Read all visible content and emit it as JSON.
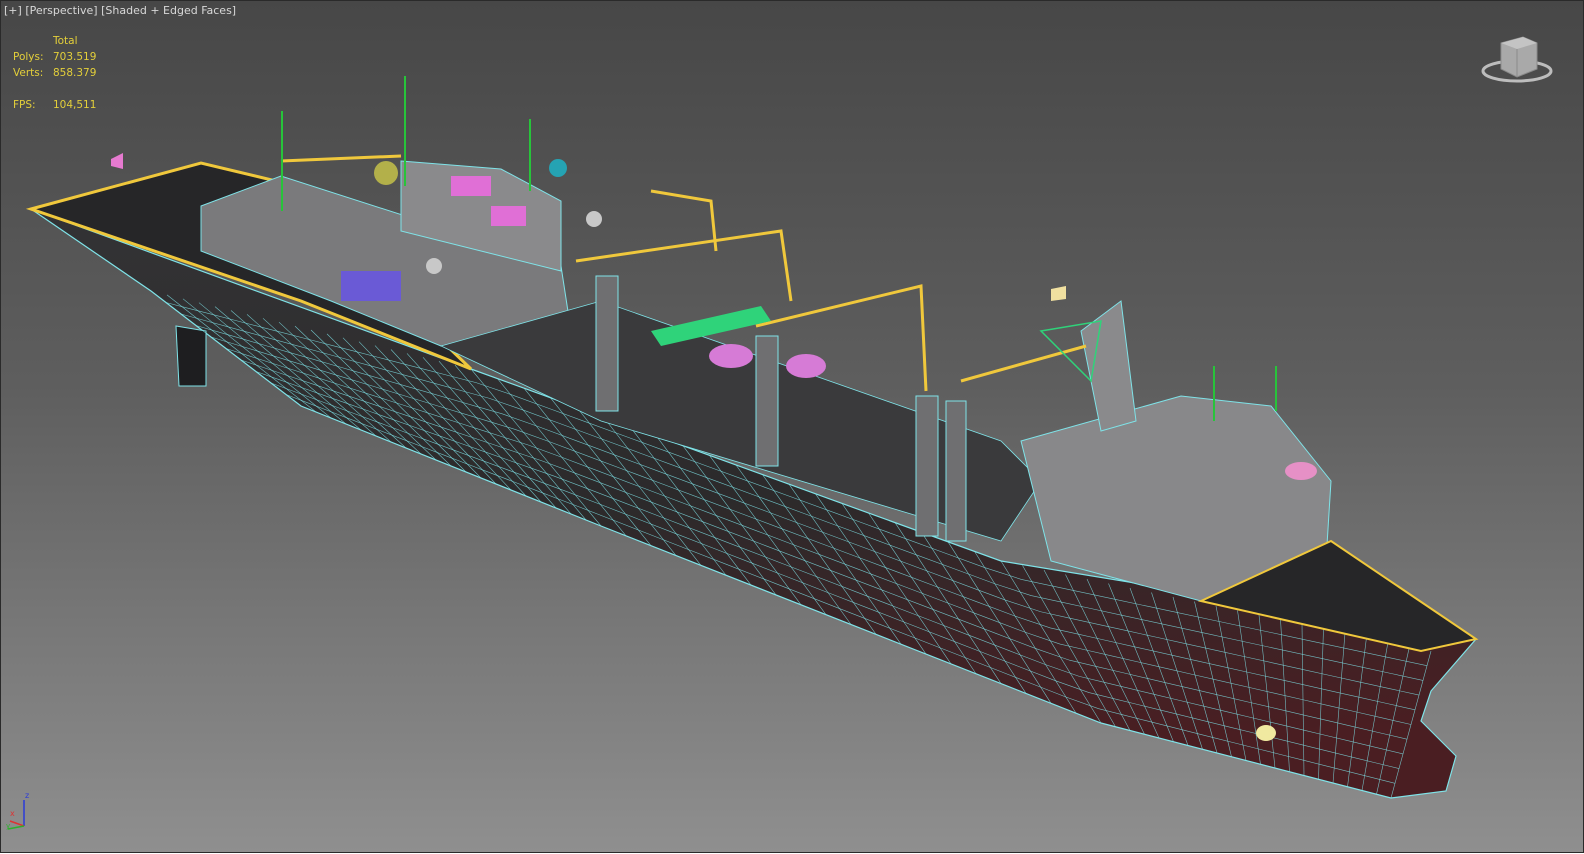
{
  "viewport": {
    "menu_label": "[+]",
    "view_label": "[Perspective]",
    "shading_label": "[Shaded + Edged Faces]"
  },
  "stats": {
    "header": "Total",
    "polys_label": "Polys:",
    "polys_value": "703.519",
    "verts_label": "Verts:",
    "verts_value": "858.379",
    "fps_label": "FPS:",
    "fps_value": "104,511"
  },
  "gizmo": {
    "x": "x",
    "y": "y",
    "z": "z"
  },
  "colors": {
    "stats_text": "#e3cf3a",
    "wire": "#7fe3e8",
    "railing": "#f0c83c",
    "hull": "#2f2f31"
  }
}
